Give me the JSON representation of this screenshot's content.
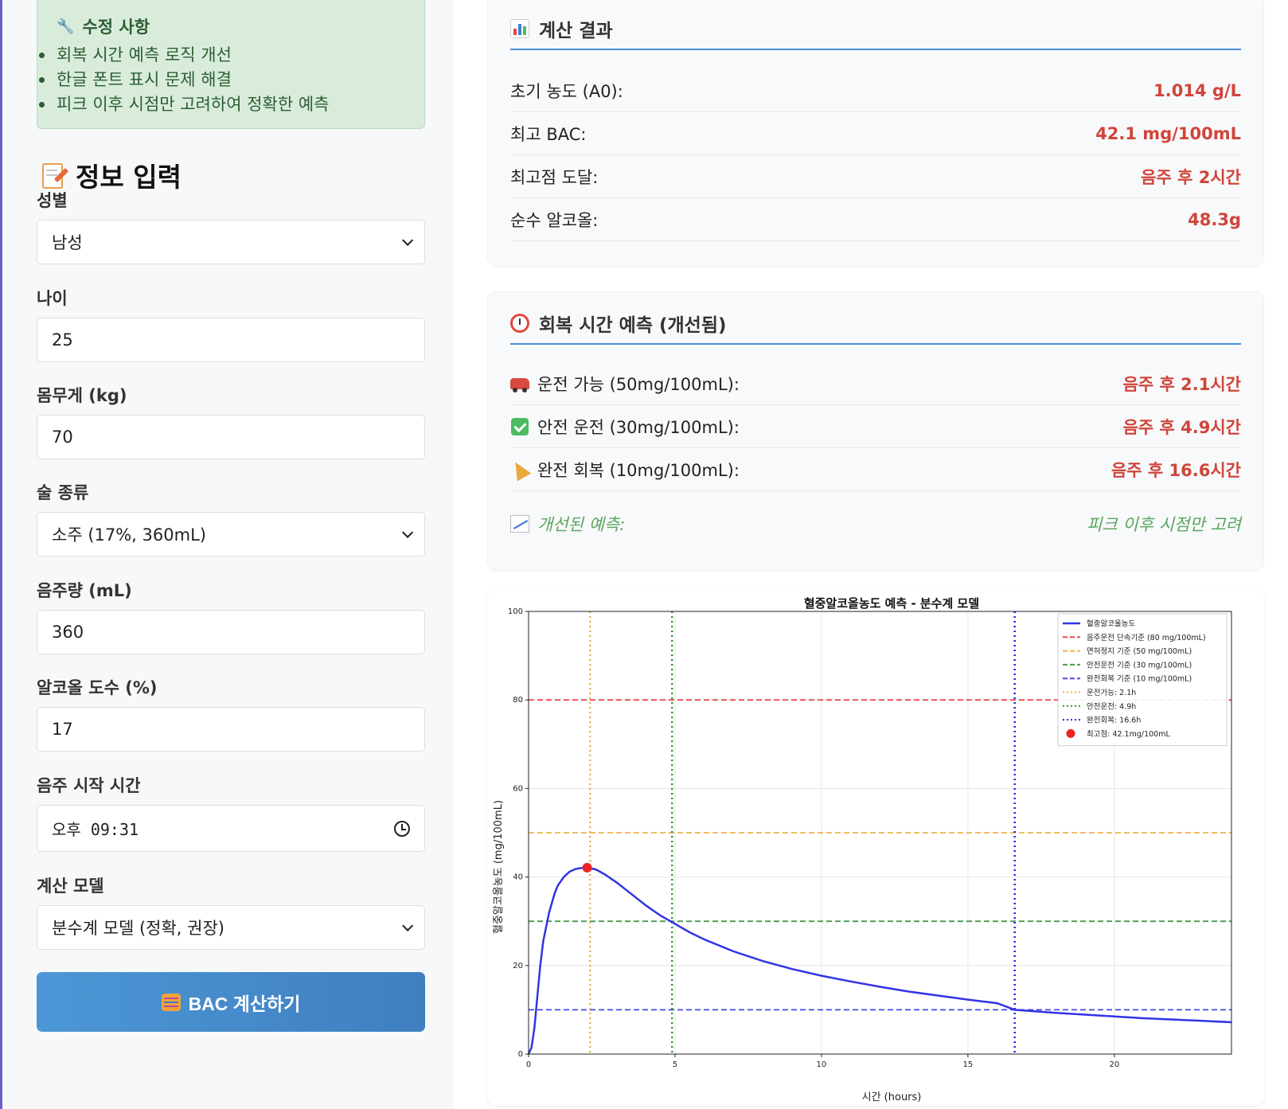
{
  "notice": {
    "title": "수정 사항",
    "items": [
      "회복 시간 예측 로직 개선",
      "한글 폰트 표시 문제 해결",
      "피크 이후 시점만 고려하여 정확한 예측"
    ]
  },
  "form": {
    "title": "정보 입력",
    "gender": {
      "label": "성별",
      "value": "남성"
    },
    "age": {
      "label": "나이",
      "value": "25"
    },
    "weight": {
      "label": "몸무게 (kg)",
      "value": "70"
    },
    "drink_type": {
      "label": "술 종류",
      "value": "소주 (17%, 360mL)"
    },
    "amount": {
      "label": "음주량 (mL)",
      "value": "360"
    },
    "abv": {
      "label": "알코올 도수 (%)",
      "value": "17"
    },
    "start_time": {
      "label": "음주 시작 시간",
      "value": "오후 09:31"
    },
    "model": {
      "label": "계산 모델",
      "value": "분수계 모델 (정확, 권장)"
    },
    "submit_label": "BAC 계산하기"
  },
  "results": {
    "title": "계산 결과",
    "rows": [
      {
        "label": "초기 농도 (A0):",
        "value": "1.014 g/L"
      },
      {
        "label": "최고 BAC:",
        "value": "42.1 mg/100mL"
      },
      {
        "label": "최고점 도달:",
        "value": "음주 후 2시간"
      },
      {
        "label": "순수 알코올:",
        "value": "48.3g"
      }
    ]
  },
  "recovery": {
    "title": "회복 시간 예측 (개선됨)",
    "rows": [
      {
        "icon": "car-icon",
        "label": "운전 가능 (50mg/100mL):",
        "value": "음주 후 2.1시간"
      },
      {
        "icon": "check-icon",
        "label": "안전 운전 (30mg/100mL):",
        "value": "음주 후 4.9시간"
      },
      {
        "icon": "party-icon",
        "label": "완전 회복 (10mg/100mL):",
        "value": "음주 후 16.6시간"
      }
    ],
    "note": {
      "icon": "trend-icon",
      "label": "개선된 예측:",
      "value": "피크 이후 시점만 고려"
    }
  },
  "colors": {
    "accent": "#4a90d9",
    "value_red": "#d0443a",
    "note_green": "#5aa65f",
    "button": "#4a8ccf"
  },
  "chart_data": {
    "type": "line",
    "title": "혈중알코올농도 예측 - 분수계 모델",
    "xlabel": "시간 (hours)",
    "ylabel": "혈중알코올농도 (mg/100mL)",
    "xlim": [
      0,
      24
    ],
    "ylim": [
      0,
      100
    ],
    "xticks": [
      0,
      5,
      10,
      15,
      20
    ],
    "yticks": [
      0,
      20,
      40,
      60,
      80,
      100
    ],
    "grid": true,
    "legend_position": "top-right",
    "series": [
      {
        "name": "혈중알코올농도",
        "color": "#3333e6",
        "x": [
          0,
          0.1,
          0.2,
          0.3,
          0.4,
          0.5,
          0.7,
          0.9,
          1.0,
          1.2,
          1.4,
          1.6,
          1.8,
          2.0,
          2.3,
          2.6,
          3.0,
          3.5,
          4.0,
          4.5,
          4.9,
          5.5,
          6.0,
          7.0,
          8.0,
          9.0,
          10.0,
          11.0,
          12.0,
          13.0,
          14.0,
          15.0,
          16.0,
          16.6,
          18.0,
          19.0,
          20.0,
          21.0,
          22.0,
          23.0,
          24.0
        ],
        "y": [
          0,
          1.5,
          6,
          13,
          20,
          25.5,
          32,
          36.5,
          38.1,
          40,
          41.2,
          41.8,
          42.05,
          42.1,
          41.7,
          40.6,
          38.8,
          36.2,
          33.6,
          31.3,
          29.8,
          27.5,
          25.9,
          23.2,
          21.0,
          19.2,
          17.7,
          16.4,
          15.2,
          14.1,
          13.2,
          12.3,
          11.5,
          10.0,
          9.3,
          8.9,
          8.5,
          8.1,
          7.8,
          7.5,
          7.2
        ]
      }
    ],
    "hlines": [
      {
        "name": "음주운전 단속기준 (80 mg/100mL)",
        "y": 80,
        "color": "#e84c4c"
      },
      {
        "name": "면허정지 기준 (50 mg/100mL)",
        "y": 50,
        "color": "#f0b24a"
      },
      {
        "name": "안전운전 기준 (30 mg/100mL)",
        "y": 30,
        "color": "#4a9a4a"
      },
      {
        "name": "완전회복 기준 (10 mg/100mL)",
        "y": 10,
        "color": "#4a4ae0"
      }
    ],
    "vlines": [
      {
        "name": "운전가능: 2.1h",
        "x": 2.1,
        "color": "#f0b24a"
      },
      {
        "name": "안전운전: 4.9h",
        "x": 4.9,
        "color": "#2a9a2a"
      },
      {
        "name": "완전회복: 16.6h",
        "x": 16.6,
        "color": "#2222ee"
      }
    ],
    "peak": {
      "name": "최고점: 42.1mg/100mL",
      "x": 2.0,
      "y": 42.1,
      "color": "#ee2222"
    }
  }
}
